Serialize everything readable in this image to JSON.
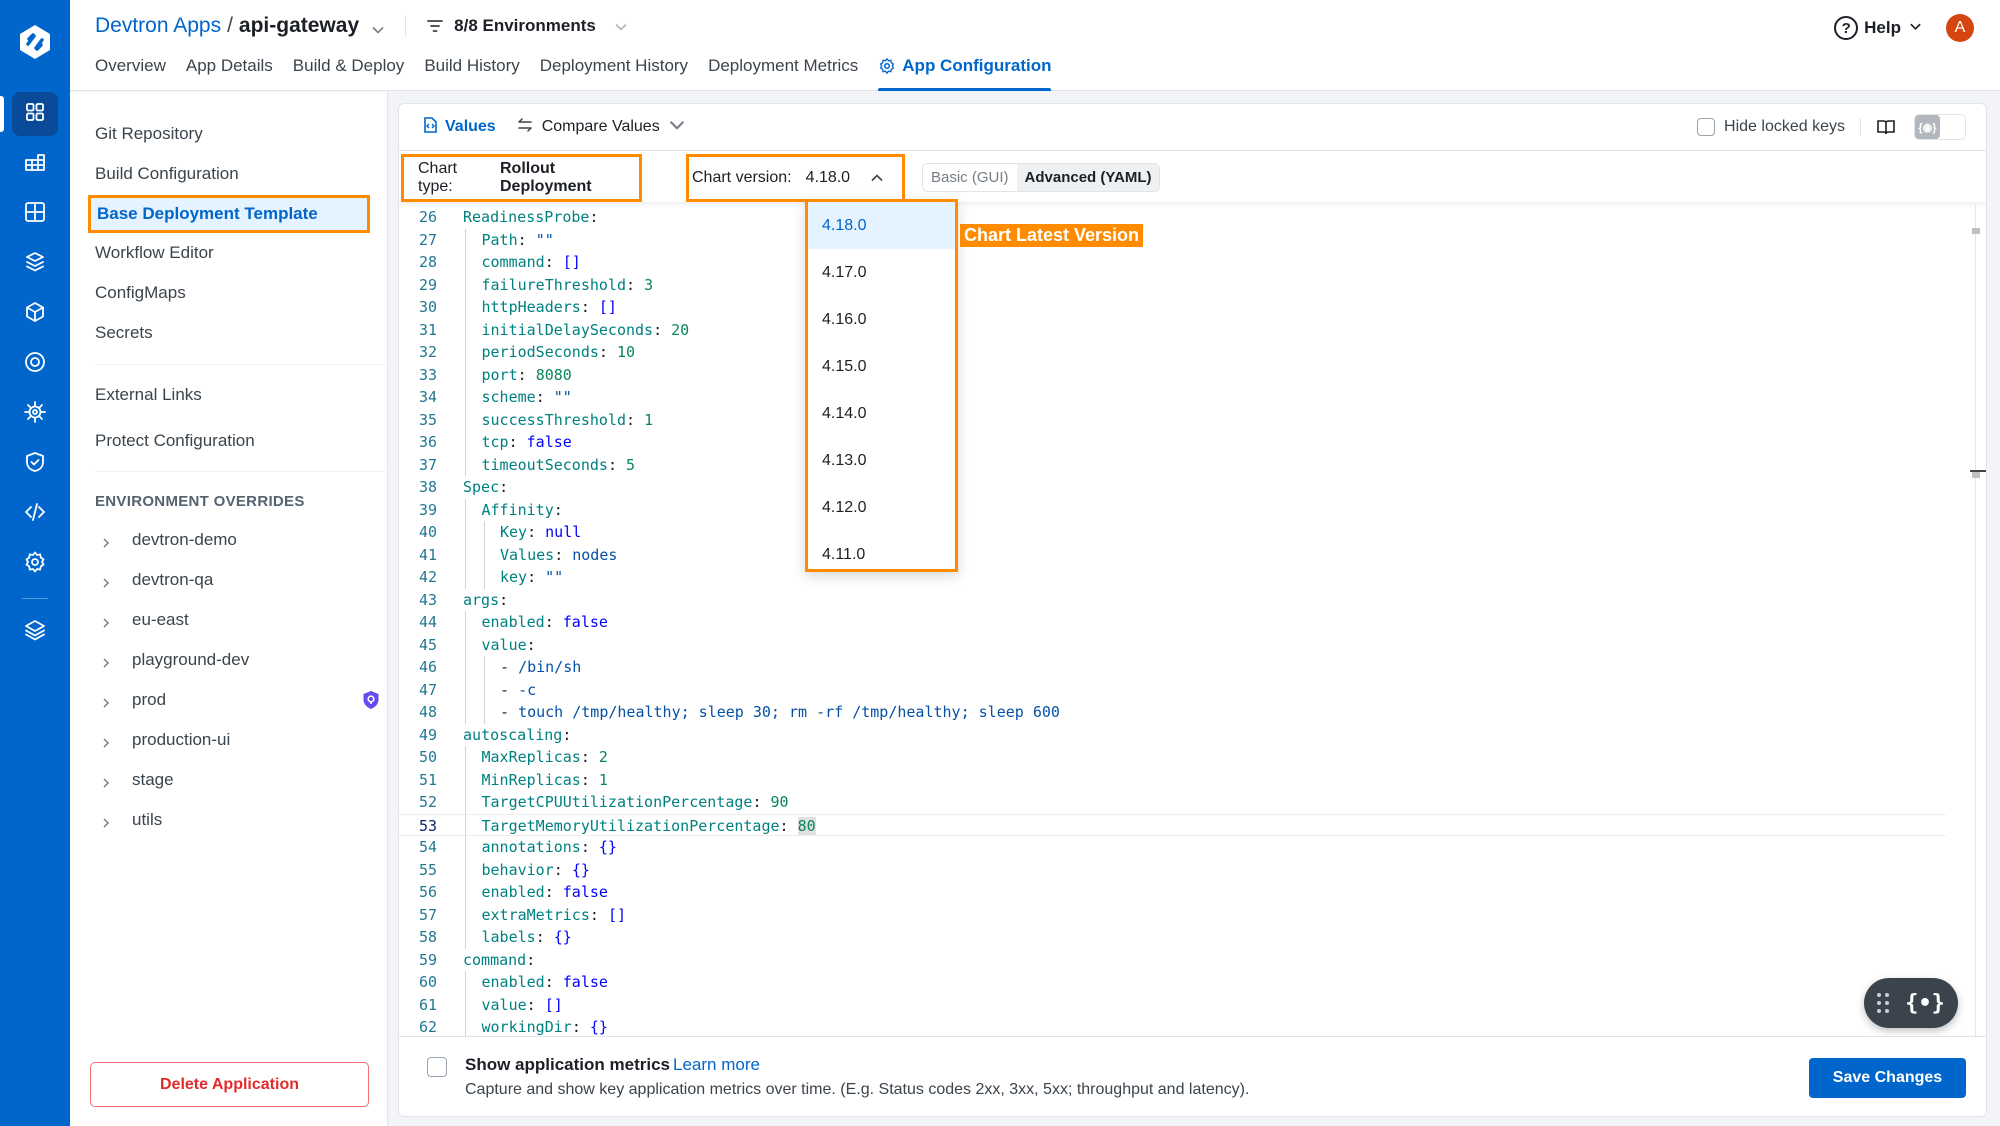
{
  "header": {
    "breadcrumb_root": "Devtron Apps",
    "breadcrumb_sep": "/",
    "app_name": "api-gateway",
    "env_filter": "8/8 Environments",
    "help_label": "Help",
    "avatar_initial": "A",
    "tabs": [
      {
        "label": "Overview"
      },
      {
        "label": "App Details"
      },
      {
        "label": "Build & Deploy"
      },
      {
        "label": "Build History"
      },
      {
        "label": "Deployment History"
      },
      {
        "label": "Deployment Metrics"
      },
      {
        "label": "App Configuration",
        "active": true
      }
    ]
  },
  "rail": {
    "icons": [
      "apps-grid-icon",
      "chart-grid-icon",
      "windows-icon",
      "stack-box-icon",
      "cube-icon",
      "target-icon",
      "helm-wheel-icon",
      "shield-check-icon",
      "code-icon",
      "gear-icon",
      "layers-icon"
    ]
  },
  "config_sidebar": {
    "items": [
      {
        "label": "Git Repository"
      },
      {
        "label": "Build Configuration"
      },
      {
        "label": "Base Deployment Template",
        "selected": true
      },
      {
        "label": "Workflow Editor"
      },
      {
        "label": "ConfigMaps"
      },
      {
        "label": "Secrets"
      }
    ],
    "extra_items": [
      {
        "label": "External Links"
      },
      {
        "label": "Protect Configuration"
      }
    ],
    "section_title": "ENVIRONMENT OVERRIDES",
    "environments": [
      {
        "label": "devtron-demo"
      },
      {
        "label": "devtron-qa"
      },
      {
        "label": "eu-east"
      },
      {
        "label": "playground-dev"
      },
      {
        "label": "prod",
        "protected": true
      },
      {
        "label": "production-ui"
      },
      {
        "label": "stage"
      },
      {
        "label": "utils"
      }
    ],
    "delete_label": "Delete Application"
  },
  "toolbar": {
    "values_label": "Values",
    "compare_label": "Compare Values",
    "hide_locked_label": "Hide locked keys",
    "chart_type_label": "Chart type:",
    "chart_type_value": "Rollout Deployment",
    "chart_version_label": "Chart version:",
    "chart_version_value": "4.18.0",
    "mode_basic": "Basic (GUI)",
    "mode_advanced": "Advanced (YAML)"
  },
  "version_dropdown": {
    "options": [
      "4.18.0",
      "4.17.0",
      "4.16.0",
      "4.15.0",
      "4.14.0",
      "4.13.0",
      "4.12.0",
      "4.11.0"
    ],
    "selected": "4.18.0",
    "annotation": "Chart Latest Version"
  },
  "editor": {
    "current_line": 53,
    "lines": [
      {
        "n": "26",
        "i": 0,
        "parts": [
          [
            "k",
            "ReadinessProbe"
          ],
          [
            "p",
            ":"
          ]
        ]
      },
      {
        "n": "27",
        "i": 1,
        "parts": [
          [
            "k",
            "Path"
          ],
          [
            "p",
            ": "
          ],
          [
            "s",
            "\"\""
          ]
        ]
      },
      {
        "n": "28",
        "i": 1,
        "parts": [
          [
            "k",
            "command"
          ],
          [
            "p",
            ": "
          ],
          [
            "b",
            "[]"
          ]
        ]
      },
      {
        "n": "29",
        "i": 1,
        "parts": [
          [
            "k",
            "failureThreshold"
          ],
          [
            "p",
            ": "
          ],
          [
            "n",
            "3"
          ]
        ]
      },
      {
        "n": "30",
        "i": 1,
        "parts": [
          [
            "k",
            "httpHeaders"
          ],
          [
            "p",
            ": "
          ],
          [
            "b",
            "[]"
          ]
        ]
      },
      {
        "n": "31",
        "i": 1,
        "parts": [
          [
            "k",
            "initialDelaySeconds"
          ],
          [
            "p",
            ": "
          ],
          [
            "n",
            "20"
          ]
        ]
      },
      {
        "n": "32",
        "i": 1,
        "parts": [
          [
            "k",
            "periodSeconds"
          ],
          [
            "p",
            ": "
          ],
          [
            "n",
            "10"
          ]
        ]
      },
      {
        "n": "33",
        "i": 1,
        "parts": [
          [
            "k",
            "port"
          ],
          [
            "p",
            ": "
          ],
          [
            "n",
            "8080"
          ]
        ]
      },
      {
        "n": "34",
        "i": 1,
        "parts": [
          [
            "k",
            "scheme"
          ],
          [
            "p",
            ": "
          ],
          [
            "s",
            "\"\""
          ]
        ]
      },
      {
        "n": "35",
        "i": 1,
        "parts": [
          [
            "k",
            "successThreshold"
          ],
          [
            "p",
            ": "
          ],
          [
            "n",
            "1"
          ]
        ]
      },
      {
        "n": "36",
        "i": 1,
        "parts": [
          [
            "k",
            "tcp"
          ],
          [
            "p",
            ": "
          ],
          [
            "b",
            "false"
          ]
        ]
      },
      {
        "n": "37",
        "i": 1,
        "parts": [
          [
            "k",
            "timeoutSeconds"
          ],
          [
            "p",
            ": "
          ],
          [
            "n",
            "5"
          ]
        ]
      },
      {
        "n": "38",
        "i": 0,
        "parts": [
          [
            "k",
            "Spec"
          ],
          [
            "p",
            ":"
          ]
        ]
      },
      {
        "n": "39",
        "i": 1,
        "parts": [
          [
            "k",
            "Affinity"
          ],
          [
            "p",
            ":"
          ]
        ]
      },
      {
        "n": "40",
        "i": 2,
        "parts": [
          [
            "k",
            "Key"
          ],
          [
            "p",
            ": "
          ],
          [
            "b",
            "null"
          ]
        ]
      },
      {
        "n": "41",
        "i": 2,
        "parts": [
          [
            "k",
            "Values"
          ],
          [
            "p",
            ": "
          ],
          [
            "s",
            "nodes"
          ]
        ]
      },
      {
        "n": "42",
        "i": 2,
        "parts": [
          [
            "k",
            "key"
          ],
          [
            "p",
            ": "
          ],
          [
            "s",
            "\"\""
          ]
        ]
      },
      {
        "n": "43",
        "i": 0,
        "parts": [
          [
            "k",
            "args"
          ],
          [
            "p",
            ":"
          ]
        ]
      },
      {
        "n": "44",
        "i": 1,
        "parts": [
          [
            "k",
            "enabled"
          ],
          [
            "p",
            ": "
          ],
          [
            "b",
            "false"
          ]
        ]
      },
      {
        "n": "45",
        "i": 1,
        "parts": [
          [
            "k",
            "value"
          ],
          [
            "p",
            ":"
          ]
        ]
      },
      {
        "n": "46",
        "i": 2,
        "parts": [
          [
            "p",
            "- "
          ],
          [
            "s",
            "/bin/sh"
          ]
        ]
      },
      {
        "n": "47",
        "i": 2,
        "parts": [
          [
            "p",
            "- "
          ],
          [
            "s",
            "-c"
          ]
        ]
      },
      {
        "n": "48",
        "i": 2,
        "parts": [
          [
            "p",
            "- "
          ],
          [
            "s",
            "touch /tmp/healthy; sleep 30; rm -rf /tmp/healthy; sleep 600"
          ]
        ]
      },
      {
        "n": "49",
        "i": 0,
        "parts": [
          [
            "k",
            "autoscaling"
          ],
          [
            "p",
            ":"
          ]
        ]
      },
      {
        "n": "50",
        "i": 1,
        "parts": [
          [
            "k",
            "MaxReplicas"
          ],
          [
            "p",
            ": "
          ],
          [
            "n",
            "2"
          ]
        ]
      },
      {
        "n": "51",
        "i": 1,
        "parts": [
          [
            "k",
            "MinReplicas"
          ],
          [
            "p",
            ": "
          ],
          [
            "n",
            "1"
          ]
        ]
      },
      {
        "n": "52",
        "i": 1,
        "parts": [
          [
            "k",
            "TargetCPUUtilizationPercentage"
          ],
          [
            "p",
            ": "
          ],
          [
            "n",
            "90"
          ]
        ]
      },
      {
        "n": "53",
        "i": 1,
        "parts": [
          [
            "k",
            "TargetMemoryUtilizationPercentage"
          ],
          [
            "p",
            ": "
          ],
          [
            "nh",
            "80"
          ]
        ]
      },
      {
        "n": "54",
        "i": 1,
        "parts": [
          [
            "k",
            "annotations"
          ],
          [
            "p",
            ": "
          ],
          [
            "b",
            "{}"
          ]
        ]
      },
      {
        "n": "55",
        "i": 1,
        "parts": [
          [
            "k",
            "behavior"
          ],
          [
            "p",
            ": "
          ],
          [
            "b",
            "{}"
          ]
        ]
      },
      {
        "n": "56",
        "i": 1,
        "parts": [
          [
            "k",
            "enabled"
          ],
          [
            "p",
            ": "
          ],
          [
            "b",
            "false"
          ]
        ]
      },
      {
        "n": "57",
        "i": 1,
        "parts": [
          [
            "k",
            "extraMetrics"
          ],
          [
            "p",
            ": "
          ],
          [
            "b",
            "[]"
          ]
        ]
      },
      {
        "n": "58",
        "i": 1,
        "parts": [
          [
            "k",
            "labels"
          ],
          [
            "p",
            ": "
          ],
          [
            "b",
            "{}"
          ]
        ]
      },
      {
        "n": "59",
        "i": 0,
        "parts": [
          [
            "k",
            "command"
          ],
          [
            "p",
            ":"
          ]
        ]
      },
      {
        "n": "60",
        "i": 1,
        "parts": [
          [
            "k",
            "enabled"
          ],
          [
            "p",
            ": "
          ],
          [
            "b",
            "false"
          ]
        ]
      },
      {
        "n": "61",
        "i": 1,
        "parts": [
          [
            "k",
            "value"
          ],
          [
            "p",
            ": "
          ],
          [
            "b",
            "[]"
          ]
        ]
      },
      {
        "n": "62",
        "i": 1,
        "parts": [
          [
            "k",
            "workingDir"
          ],
          [
            "p",
            ": "
          ],
          [
            "b",
            "{}"
          ]
        ]
      }
    ]
  },
  "footer": {
    "metrics_title": "Show application metrics",
    "learn_more": "Learn more",
    "metrics_desc": "Capture and show key application metrics over time. (E.g. Status codes 2xx, 3xx, 5xx; throughput and latency).",
    "save_label": "Save Changes"
  },
  "colors": {
    "brand": "#0066cc",
    "annotation": "#ff8c00",
    "danger": "#e02c2c"
  }
}
